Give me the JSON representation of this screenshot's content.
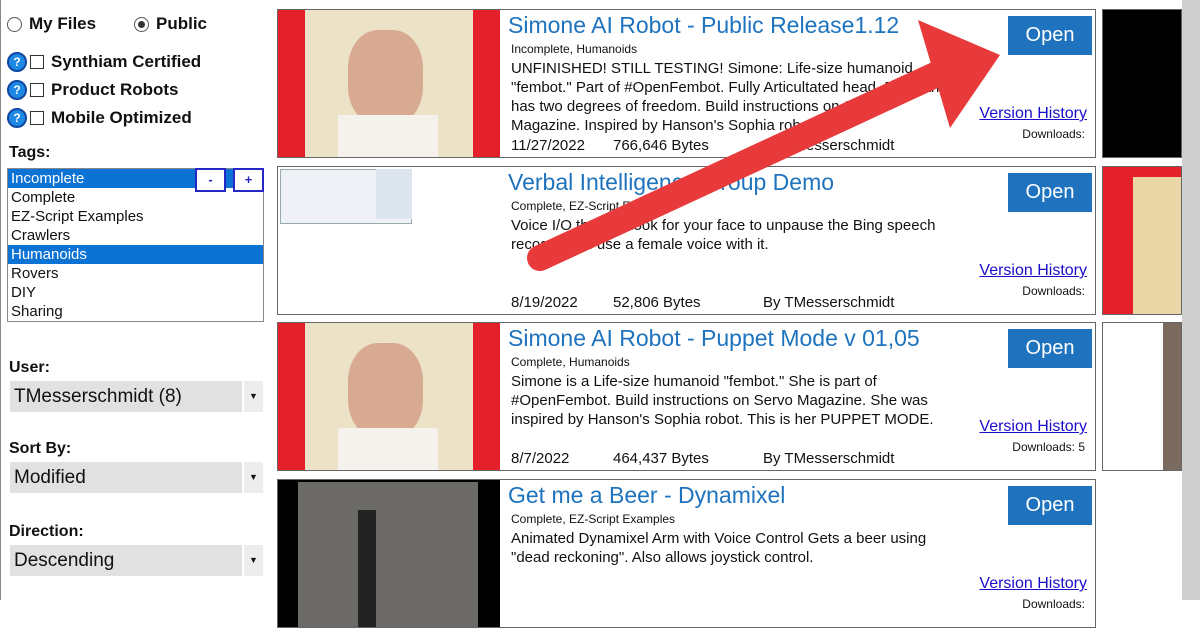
{
  "filters": {
    "my_files": "My Files",
    "public": "Public",
    "selected": "Public",
    "checks": [
      {
        "label": "Synthiam Certified",
        "checked": false
      },
      {
        "label": "Product Robots",
        "checked": false
      },
      {
        "label": "Mobile Optimized",
        "checked": false
      }
    ],
    "tags_label": "Tags:",
    "tags": [
      {
        "label": "Incomplete",
        "selected": true
      },
      {
        "label": "Complete",
        "selected": false
      },
      {
        "label": "EZ-Script Examples",
        "selected": false
      },
      {
        "label": "Crawlers",
        "selected": false
      },
      {
        "label": "Humanoids",
        "selected": true
      },
      {
        "label": "Rovers",
        "selected": false
      },
      {
        "label": "DIY",
        "selected": false
      },
      {
        "label": "Sharing",
        "selected": false
      }
    ],
    "minus": "-",
    "plus": "+",
    "user_label": "User:",
    "user_value": "TMesserschmidt (8)",
    "sort_label": "Sort By:",
    "sort_value": "Modified",
    "direction_label": "Direction:",
    "direction_value": "Descending"
  },
  "cards": [
    {
      "title": "Simone AI Robot - Public Release1.12",
      "tags": "Incomplete, Humanoids",
      "description": "UNFINISHED! STILL TESTING! Simone: Life-size humanoid \"fembot.\" Part of #OpenFembot. Fully Articultated head. Each arm has two degrees of freedom. Build instructions on Servo Magazine. Inspired by Hanson's Sophia robot.",
      "date": "11/27/2022",
      "size": "766,646 Bytes",
      "author": "By TMesserschmidt",
      "open": "Open",
      "version_history": "Version History",
      "downloads": "Downloads:",
      "thumb": "face"
    },
    {
      "title": "Verbal Intelligence Group Demo",
      "tags": "Complete, EZ-Script Examples",
      "description": "Voice I/O that will look for your face to unpause the Bing speech recognizer. I use a female voice with it.",
      "date": "8/19/2022",
      "size": "52,806 Bytes",
      "author": "By TMesserschmidt",
      "open": "Open",
      "version_history": "Version History",
      "downloads": "Downloads:",
      "thumb": "screen"
    },
    {
      "title": "Simone AI Robot - Puppet Mode v 01,05",
      "tags": "Complete, Humanoids",
      "description": "Simone is a Life-size humanoid \"fembot.\" She is part of #OpenFembot. Build instructions on Servo Magazine. She was inspired by Hanson's Sophia robot. This is her PUPPET MODE.",
      "date": "8/7/2022",
      "size": "464,437 Bytes",
      "author": "By TMesserschmidt",
      "open": "Open",
      "version_history": "Version History",
      "downloads": "Downloads: 5",
      "thumb": "face"
    },
    {
      "title": "Get me a Beer - Dynamixel",
      "tags": "Complete, EZ-Script Examples",
      "description": "Animated Dynamixel Arm with Voice Control Gets a beer using \"dead reckoning\". Also allows joystick control.",
      "date": "",
      "size": "",
      "author": "",
      "open": "Open",
      "version_history": "Version History",
      "downloads": "Downloads:",
      "thumb": "arm"
    }
  ],
  "colors": {
    "accent": "#1e72be",
    "selection": "#0c72d4",
    "thumb_red": "#e4202a",
    "arrow": "#e83a3a"
  }
}
